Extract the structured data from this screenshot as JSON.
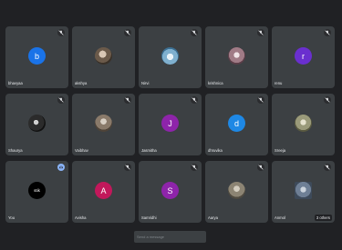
{
  "participants": [
    {
      "name": "bhavyaa",
      "initial": "b",
      "color": "#1a73e8",
      "type": "letter"
    },
    {
      "name": "akshya",
      "initial": "",
      "color": "#6b5a4a",
      "type": "photo"
    },
    {
      "name": "Nirvi",
      "initial": "",
      "color": "#7fb0cf",
      "type": "photo"
    },
    {
      "name": "krishnica",
      "initial": "",
      "color": "#a07b86",
      "type": "photo"
    },
    {
      "name": "renu",
      "initial": "r",
      "color": "#6a2fcf",
      "type": "letter"
    },
    {
      "name": "Shaurya",
      "initial": "",
      "color": "#2b2b2b",
      "type": "photo"
    },
    {
      "name": "Vaibhav",
      "initial": "",
      "color": "#8a7a6a",
      "type": "photo"
    },
    {
      "name": "Jasmitha",
      "initial": "J",
      "color": "#8e24aa",
      "type": "letter"
    },
    {
      "name": "dhruvika",
      "initial": "d",
      "color": "#1e88e5",
      "type": "letter"
    },
    {
      "name": "Sreeja",
      "initial": "",
      "color": "#9a9a7a",
      "type": "photo"
    },
    {
      "name": "You",
      "initial": "stik",
      "color": "#000000",
      "type": "letter"
    },
    {
      "name": "Avisha",
      "initial": "A",
      "color": "#c2185b",
      "type": "letter"
    },
    {
      "name": "Samridhi",
      "initial": "S",
      "color": "#8e24aa",
      "type": "letter"
    },
    {
      "name": "Aarya",
      "initial": "",
      "color": "#8c8473",
      "type": "photo"
    },
    {
      "name": "Anmol",
      "initial": "",
      "color": "#6e7f95",
      "type": "photo"
    }
  ],
  "others_label": "3 others",
  "chat": {
    "placeholder": "Send a message"
  },
  "colors": {
    "background": "#202124",
    "tile": "#3c4043",
    "speaking": "#8ab4f8"
  }
}
